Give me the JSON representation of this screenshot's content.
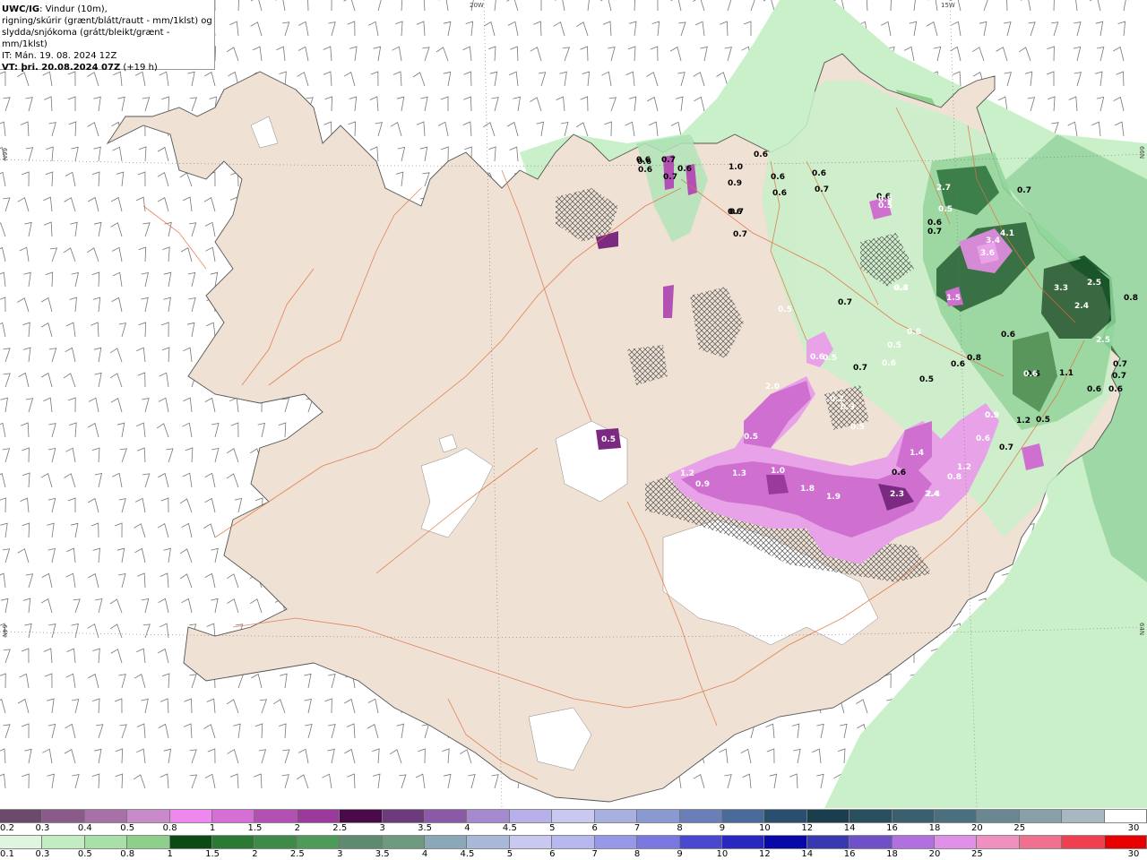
{
  "header": {
    "model": "UWC/IG",
    "line1_suffix": ": Vindur (10m),",
    "line2": "rigning/skúrir (grænt/blátt/rautt - mm/1klst) og",
    "line3": "slydda/snjókoma (grátt/bleikt/grænt - mm/1klst)",
    "line4": "IT: Mán. 19. 08. 2024 12Z",
    "line5_bold": "VT: þri. 20.08.2024 07Z",
    "line5_suffix": " (+19 h)"
  },
  "graticule": {
    "lon_labels": [
      "20W",
      "15W"
    ],
    "lat_labels_left": [
      "66N",
      "64N"
    ],
    "lat_labels_right": [
      "66N",
      "64N"
    ]
  },
  "colors": {
    "land": "#efe1d3",
    "sea": "#ffffff",
    "glacier": "#ffffff",
    "roads": "#e07040",
    "coast": "#555555",
    "rain_light": "#c9f0c9",
    "rain_mid": "#8fd69a",
    "rain_dark": "#1f6e33",
    "snow_light": "#e8a2e8",
    "snow_mid": "#cf6fcf",
    "snow_dark": "#7a2a80"
  },
  "precip_values": [
    {
      "v": "0.6",
      "tone": "dark"
    },
    {
      "v": "0.7",
      "tone": "dark"
    },
    {
      "v": "0.6",
      "tone": "dark"
    },
    {
      "v": "0.7",
      "tone": "dark"
    },
    {
      "v": "0.6",
      "tone": "dark"
    },
    {
      "v": "0.6",
      "tone": "dark"
    },
    {
      "v": "1.0",
      "tone": "dark"
    },
    {
      "v": "0.9",
      "tone": "dark"
    },
    {
      "v": "0.6",
      "tone": "dark"
    },
    {
      "v": "0.6",
      "tone": "dark"
    },
    {
      "v": "0.7",
      "tone": "dark"
    },
    {
      "v": "0.6",
      "tone": "dark"
    },
    {
      "v": "0.7",
      "tone": "dark"
    },
    {
      "v": "0.6",
      "tone": "dark"
    },
    {
      "v": "0.6",
      "tone": "dark"
    },
    {
      "v": "0.7",
      "tone": "dark"
    },
    {
      "v": "2.7",
      "tone": "light"
    },
    {
      "v": "0.5",
      "tone": "light"
    },
    {
      "v": "0.7",
      "tone": "dark"
    },
    {
      "v": "0.6",
      "tone": "dark"
    },
    {
      "v": "0.5",
      "tone": "light"
    },
    {
      "v": "0.6",
      "tone": "dark"
    },
    {
      "v": "0.7",
      "tone": "dark"
    },
    {
      "v": "4.1",
      "tone": "light"
    },
    {
      "v": "3.4",
      "tone": "light"
    },
    {
      "v": "3.6",
      "tone": "light"
    },
    {
      "v": "3.3",
      "tone": "light"
    },
    {
      "v": "2.5",
      "tone": "light"
    },
    {
      "v": "0.8",
      "tone": "dark"
    },
    {
      "v": "1.5",
      "tone": "light"
    },
    {
      "v": "2.4",
      "tone": "light"
    },
    {
      "v": "0.7",
      "tone": "dark"
    },
    {
      "v": "0.6",
      "tone": "dark"
    },
    {
      "v": "2.5",
      "tone": "light"
    },
    {
      "v": "0.8",
      "tone": "dark"
    },
    {
      "v": "0.6",
      "tone": "dark"
    },
    {
      "v": "0.7",
      "tone": "dark"
    },
    {
      "v": "0.5",
      "tone": "dark"
    },
    {
      "v": "0.7",
      "tone": "dark"
    },
    {
      "v": "1.1",
      "tone": "dark"
    },
    {
      "v": "0.5",
      "tone": "dark"
    },
    {
      "v": "0.6",
      "tone": "dark"
    },
    {
      "v": "0.6",
      "tone": "dark"
    },
    {
      "v": "0.7",
      "tone": "dark"
    },
    {
      "v": "1.2",
      "tone": "dark"
    },
    {
      "v": "0.5",
      "tone": "dark"
    },
    {
      "v": "0.7",
      "tone": "dark"
    },
    {
      "v": "0.9",
      "tone": "light"
    },
    {
      "v": "0.6",
      "tone": "light"
    },
    {
      "v": "1.4",
      "tone": "light"
    },
    {
      "v": "2.4",
      "tone": "light"
    },
    {
      "v": "2.0",
      "tone": "light"
    },
    {
      "v": "0.5",
      "tone": "light"
    },
    {
      "v": "1.3",
      "tone": "light"
    },
    {
      "v": "1.0",
      "tone": "light"
    },
    {
      "v": "0.9",
      "tone": "light"
    },
    {
      "v": "1.2",
      "tone": "light"
    },
    {
      "v": "1.8",
      "tone": "light"
    },
    {
      "v": "1.9",
      "tone": "light"
    },
    {
      "v": "2.3",
      "tone": "light"
    },
    {
      "v": "2.4",
      "tone": "light"
    },
    {
      "v": "0.8",
      "tone": "light"
    },
    {
      "v": "1.2",
      "tone": "light"
    },
    {
      "v": "0.6",
      "tone": "dark"
    },
    {
      "v": "0.5",
      "tone": "light"
    },
    {
      "v": "0.5",
      "tone": "light"
    },
    {
      "v": "0.6",
      "tone": "light"
    },
    {
      "v": "0.5",
      "tone": "light"
    },
    {
      "v": "0.2",
      "tone": "light"
    },
    {
      "v": "0.3",
      "tone": "light"
    },
    {
      "v": "0.5",
      "tone": "light"
    },
    {
      "v": "0.3",
      "tone": "light"
    },
    {
      "v": "0.5",
      "tone": "light"
    },
    {
      "v": "0.6",
      "tone": "light"
    },
    {
      "v": "0.6",
      "tone": "light"
    },
    {
      "v": "0.9",
      "tone": "light"
    },
    {
      "v": "0.4",
      "tone": "light"
    },
    {
      "v": "0.8",
      "tone": "light"
    },
    {
      "v": "0.5",
      "tone": "light"
    }
  ],
  "legend_snow": {
    "colors": [
      "#6b4a6b",
      "#8a5a8a",
      "#a770a7",
      "#c88ac8",
      "#ee88ee",
      "#d56fd5",
      "#b350b3",
      "#9a3a9a",
      "#4a0a4a",
      "#6e3a7e",
      "#8a5aa8",
      "#a58acd",
      "#b8b0e8",
      "#c8c8f0",
      "#a8b0e0",
      "#8a9ad0",
      "#6a7eb8",
      "#4a6a9a",
      "#2a4e6e",
      "#1a3e4e",
      "#2a5060",
      "#3a6070",
      "#4a7080",
      "#6a8890",
      "#88a0a8",
      "#a8b8c0",
      "#ffffff"
    ],
    "labels": [
      "0.2",
      "0.3",
      "0.4",
      "0.5",
      "0.8",
      "1",
      "1.5",
      "2",
      "2.5",
      "3",
      "3.5",
      "4",
      "4.5",
      "5",
      "6",
      "7",
      "8",
      "9",
      "10",
      "12",
      "14",
      "16",
      "18",
      "20",
      "25",
      "30"
    ]
  },
  "legend_rain": {
    "colors": [
      "#dff5df",
      "#c2ecc2",
      "#a8e0a8",
      "#8cd08c",
      "#0a4a14",
      "#2a7a34",
      "#3e8a48",
      "#4e9a58",
      "#5e8a70",
      "#6e9a80",
      "#8aa8b8",
      "#a8b8d8",
      "#c8c8f0",
      "#b8b8f0",
      "#9898e8",
      "#7878e0",
      "#4848d0",
      "#2828c0",
      "#0808a8",
      "#3838b0",
      "#7050c8",
      "#b070e0",
      "#e090e8",
      "#f090c0",
      "#f07090",
      "#f04050",
      "#e80000"
    ],
    "labels": [
      "0.1",
      "0.3",
      "0.5",
      "0.8",
      "1",
      "1.5",
      "2",
      "2.5",
      "3",
      "3.5",
      "4",
      "4.5",
      "5",
      "6",
      "7",
      "8",
      "9",
      "10",
      "12",
      "14",
      "16",
      "18",
      "20",
      "25",
      "30"
    ]
  }
}
